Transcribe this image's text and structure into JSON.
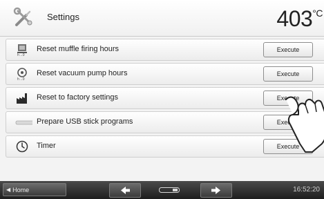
{
  "header": {
    "title": "Settings",
    "temperature": "403",
    "unit": "°C"
  },
  "rows": [
    {
      "label": "Reset muffle firing hours",
      "button": "Execute",
      "icon": "muffle-hours-icon"
    },
    {
      "label": "Reset vacuum pump hours",
      "button": "Execute",
      "icon": "vacuum-pump-icon"
    },
    {
      "label": "Reset to factory settings",
      "button": "Execute",
      "icon": "factory-icon"
    },
    {
      "label": "Prepare USB stick programs",
      "button": "Execute",
      "icon": "usb-stick-icon"
    },
    {
      "label": "Timer",
      "button": "Execute",
      "icon": "timer-icon"
    }
  ],
  "footer": {
    "home_label": "Home",
    "time": "16:52:20"
  }
}
